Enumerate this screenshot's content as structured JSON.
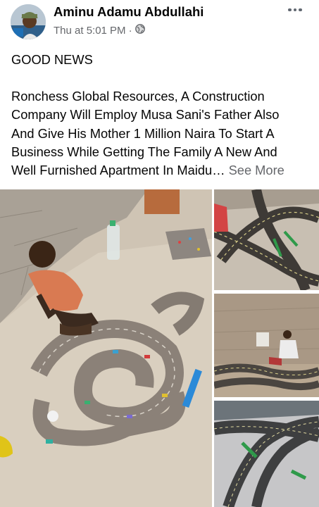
{
  "post": {
    "author_name": "Aminu Adamu Abdullahi",
    "timestamp": "Thu at 5:01 PM",
    "separator": "·",
    "privacy_icon": "globe-icon",
    "more_icon": "more-options-icon",
    "headline": "GOOD NEWS",
    "body_lines": [
      "Ronchess Global Resources,  A Construction",
      "Company Will Employ Musa Sani's Father Also",
      "And Give His Mother 1 Million Naira To Start A",
      "Business While Getting The Family A New And",
      "Well Furnished Apartment In Maidu…"
    ],
    "see_more_label": "See More"
  },
  "photos": [
    {
      "subject": "boy-with-clay-road-model"
    },
    {
      "subject": "clay-interchange-closeup"
    },
    {
      "subject": "boy-seated-by-clay-wall"
    },
    {
      "subject": "clay-overpass-closeup"
    }
  ],
  "colors": {
    "name_text": "#050505",
    "meta_text": "#65676b",
    "see_more": "#65676b",
    "background": "#ffffff"
  }
}
